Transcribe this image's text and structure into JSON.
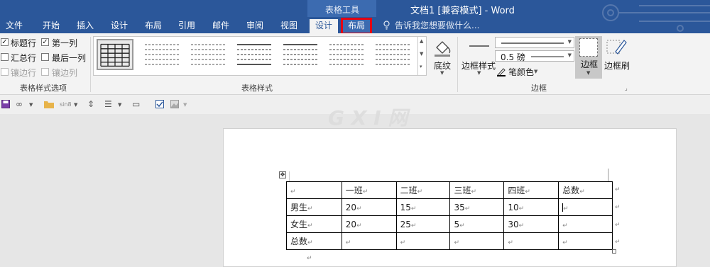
{
  "titlebar": {
    "context_group": "表格工具",
    "doc_title": "文档1 [兼容模式] - Word"
  },
  "tabs": [
    {
      "label": "文件"
    },
    {
      "label": "开始"
    },
    {
      "label": "插入"
    },
    {
      "label": "设计"
    },
    {
      "label": "布局"
    },
    {
      "label": "引用"
    },
    {
      "label": "邮件"
    },
    {
      "label": "审阅"
    },
    {
      "label": "视图"
    },
    {
      "label": "设计",
      "state": "active"
    },
    {
      "label": "布局",
      "state": "highlighted"
    }
  ],
  "tellme": "告诉我您想要做什么...",
  "style_options": {
    "header_row": "标题行",
    "first_column": "第一列",
    "total_row": "汇总行",
    "last_column": "最后一列",
    "banded_rows": "镶边行",
    "banded_columns": "镶边列",
    "group_label": "表格样式选项"
  },
  "table_styles": {
    "group_label": "表格样式"
  },
  "shading": {
    "label": "底纹"
  },
  "borders": {
    "border_styles_label": "边框样式",
    "weight_value": "0.5 磅",
    "pen_color_label": "笔颜色",
    "borders_label": "边框",
    "painter_label": "边框刷",
    "group_label": "边框"
  },
  "qat": {
    "font_name": "sin8"
  },
  "watermark": "G X I 网",
  "colors": {
    "accent": "#2b579a",
    "highlight_box": "#e30613"
  },
  "document_table": {
    "headers": [
      "",
      "一班",
      "二班",
      "三班",
      "四班",
      "总数"
    ],
    "rows": [
      [
        "男生",
        "20",
        "15",
        "35",
        "10",
        ""
      ],
      [
        "女生",
        "20",
        "25",
        "5",
        "30",
        ""
      ],
      [
        "总数",
        "",
        "",
        "",
        "",
        ""
      ]
    ]
  }
}
